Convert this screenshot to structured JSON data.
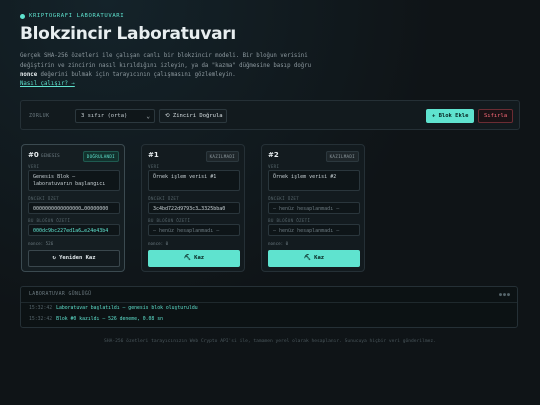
{
  "header": {
    "eyebrow": "KRIPTOGRAFI LABORATUVARI",
    "title": "Blokzincir Laboratuvarı",
    "intro_part1": "Gerçek SHA-256 özetleri ile çalışan canlı bir blokzincir modeli. Bir bloğun verisini değiştirin ve zincirin nasıl kırıldığını izleyin, ya da \"kazma\" düğmesine basıp doğru ",
    "intro_bold": "nonce",
    "intro_part2": " değerini bulmak için tarayıcının çalışmasını gözlemleyin.",
    "how_link": "Nasıl çalışır? →"
  },
  "controls": {
    "difficulty_label": "ZORLUK",
    "difficulty_value": "3 sıfır (orta)",
    "validate_label": "⟲ Zinciri Doğrula",
    "add_block_label": "+ Blok Ekle",
    "reset_label": "Sıfırla"
  },
  "blocks": [
    {
      "title": "#0",
      "subtitle": "GENESIS",
      "badge": "DOĞRULANDI",
      "data_label": "VERI",
      "data": "Genesis Blok — laboratuvarın başlangıcı",
      "prev_label": "ÖNCEKİ ÖZET",
      "prev_hash": "0000000000000000…00000000",
      "hash_label": "BU BLOĞUN ÖZETİ",
      "hash": "000dc9bc227ed1a6…e24e43b4",
      "nonce": "nonce: 526",
      "button": "↻ Yeniden Kaz"
    },
    {
      "title": "#1",
      "subtitle": "",
      "badge": "KAZILMADI",
      "data_label": "VERI",
      "data": "Örnek işlem verisi #1",
      "prev_label": "ÖNCEKİ ÖZET",
      "prev_hash": "3c4bd722d9793c3…3325bba0",
      "hash_label": "BU BLOĞUN ÖZETİ",
      "hash": "— henüz hesaplanmadı —",
      "nonce": "nonce: 0",
      "button": "⛏ Kaz"
    },
    {
      "title": "#2",
      "subtitle": "",
      "badge": "KAZILMADI",
      "data_label": "VERI",
      "data": "Örnek işlem verisi #2",
      "prev_label": "ÖNCEKİ ÖZET",
      "prev_hash": "— henüz hesaplanmadı —",
      "hash_label": "BU BLOĞUN ÖZETİ",
      "hash": "— henüz hesaplanmadı —",
      "nonce": "nonce: 0",
      "button": "⛏ Kaz"
    }
  ],
  "log": {
    "title": "LABORATUVAR GÜNLÜĞÜ",
    "dots": "●●●",
    "entries": [
      {
        "time": "15:32:42",
        "text": "Laboratuvar başlatıldı — genesis blok oluşturuldu"
      },
      {
        "time": "15:32:42",
        "text": "Blok #0 kazıldı — 526 deneme, 0.08 sn"
      }
    ]
  },
  "footer": "SHA-256 özetleri tarayıcınızın Web Crypto API'si ile, tamamen yerel olarak hesaplanır. Sunucuya hiçbir veri gönderilmez.",
  "colors": {
    "accent": "#5fe3cf",
    "danger": "#ff6b7a",
    "background": "#0f1417"
  }
}
